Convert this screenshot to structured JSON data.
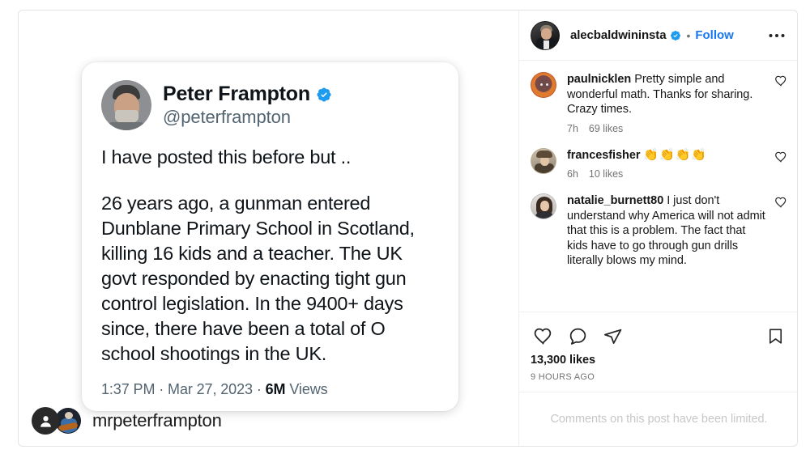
{
  "post": {
    "media": {
      "tweet": {
        "display_name": "Peter Frampton",
        "handle": "@peterframpton",
        "verified_icon": "verified-badge-icon",
        "line1": "I have posted this before but ..",
        "line2": "26 years ago, a gunman entered Dunblane Primary School in Scotland, killing 16 kids and a teacher. The UK govt responded by enacting tight gun control legislation. In the 9400+ days since, there have been a total of O school shootings in the UK.",
        "time": "1:37 PM",
        "separator1": " · ",
        "date": "Mar 27, 2023",
        "separator2": " · ",
        "views_count": "6M",
        "views_label": " Views"
      },
      "tag_overlay": {
        "badge_icon": "tagged-people-icon",
        "avatar_icon": "mrpeterframpton-avatar",
        "username": "mrpeterframpton"
      }
    },
    "header": {
      "avatar_icon": "alecbaldwininsta-avatar",
      "username": "alecbaldwininsta",
      "verified_icon": "verified-badge-icon",
      "separator": "•",
      "follow_label": "Follow",
      "more_icon": "more-options-icon"
    },
    "comments": [
      {
        "avatar_icon": "paulnicklen-avatar",
        "username": "paulnicklen",
        "text": "Pretty simple and wonderful math. Thanks for sharing. Crazy times.",
        "time": "7h",
        "likes": "69 likes",
        "like_icon": "heart-outline-icon"
      },
      {
        "avatar_icon": "francesfisher-avatar",
        "username": "francesfisher",
        "text": "👏👏👏👏",
        "time": "6h",
        "likes": "10 likes",
        "like_icon": "heart-outline-icon"
      },
      {
        "avatar_icon": "natalie_burnett80-avatar",
        "username": "natalie_burnett80",
        "text": "I just don't understand why America will not admit that this is a problem. The fact that kids have to go through gun drills literally blows my mind.",
        "time": "",
        "likes": "",
        "like_icon": "heart-outline-icon"
      }
    ],
    "actions": {
      "like_icon": "heart-outline-icon",
      "comment_icon": "comment-bubble-icon",
      "share_icon": "share-paper-plane-icon",
      "save_icon": "bookmark-outline-icon",
      "likes_count": "13,300 likes",
      "posted_time": "9 HOURS AGO"
    },
    "footer": {
      "notice": "Comments on this post have been limited."
    }
  },
  "colors": {
    "instagram_blue": "#1877f2",
    "verified_blue": "#1d9bf0",
    "text_primary": "#171717",
    "text_secondary": "#737373",
    "border": "#efefef",
    "footer_text": "#c7c7c7"
  }
}
